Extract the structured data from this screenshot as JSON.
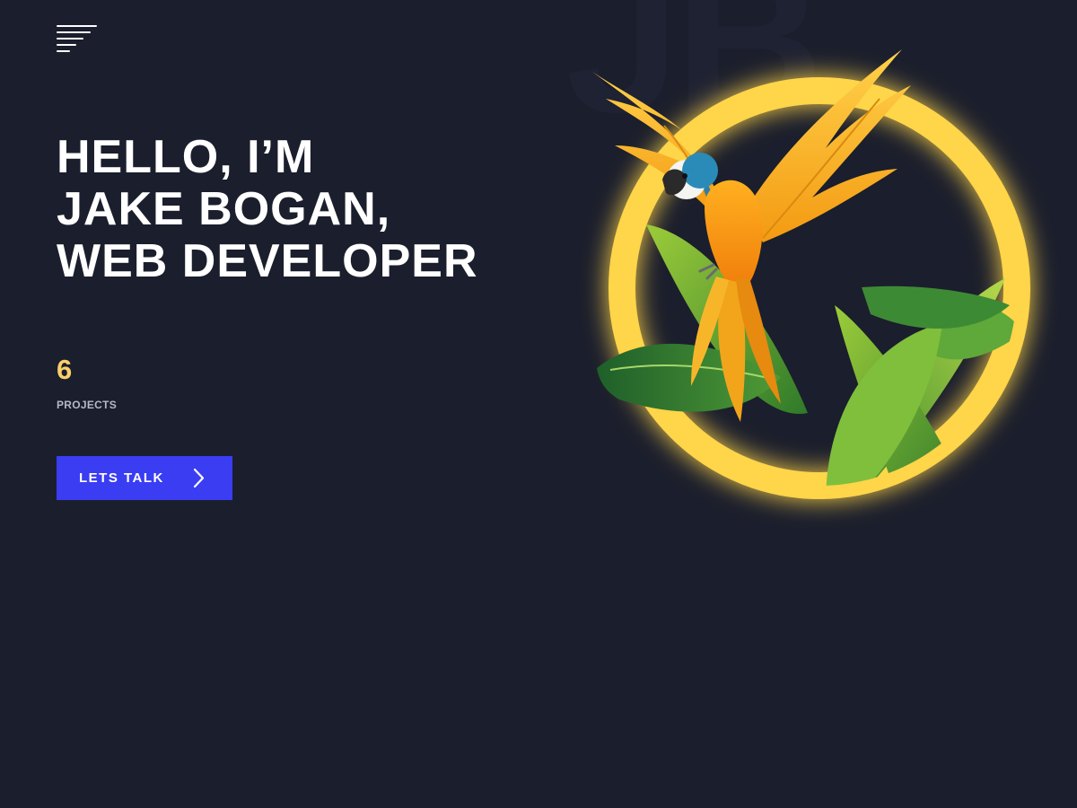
{
  "header": {
    "menu_icon": "hamburger-menu-icon"
  },
  "hero": {
    "line1": "HELLO, I’M",
    "line2": "JAKE BOGAN,",
    "line3": "WEB DEVELOPER"
  },
  "stats": {
    "count": "6",
    "label": "PROJECTS"
  },
  "cta": {
    "label": "LETS TALK",
    "icon": "chevron-right-icon"
  },
  "illustration": {
    "subject": "parrot-with-leaves-in-yellow-ring",
    "ring_color": "#ffd54a"
  },
  "colors": {
    "background": "#1b1e2c",
    "accent": "#f8d06a",
    "button": "#3b3df3",
    "text": "#ffffff",
    "muted": "#b4b8c8"
  }
}
